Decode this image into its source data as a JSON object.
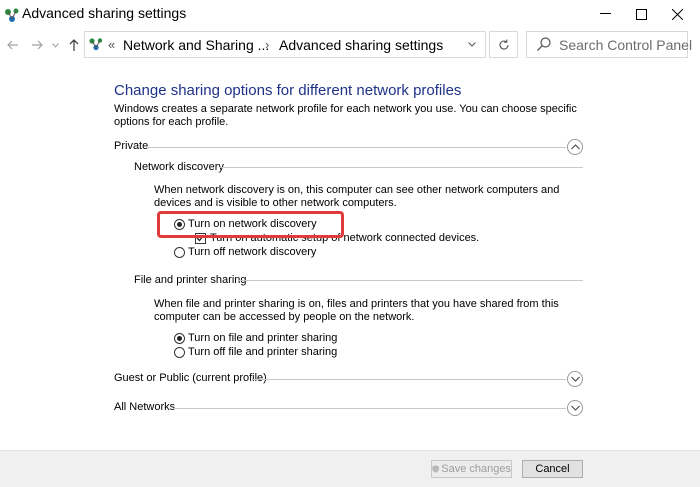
{
  "window": {
    "title": "Advanced sharing settings",
    "minimize_icon": "minimize-icon",
    "maximize_icon": "maximize-icon",
    "close_icon": "close-icon"
  },
  "nav": {
    "back_icon": "back-arrow-icon",
    "forward_icon": "forward-arrow-icon",
    "recent_icon": "chevron-down-icon",
    "up_icon": "up-arrow-icon",
    "breadcrumb_prefix": "«",
    "breadcrumbs": [
      "Network and Sharing ...",
      "Advanced sharing settings"
    ],
    "breadcrumb_sep": "›",
    "refresh_icon": "refresh-icon",
    "search_placeholder": "Search Control Panel"
  },
  "content": {
    "heading": "Change sharing options for different network profiles",
    "description": "Windows creates a separate network profile for each network you use. You can choose specific options for each profile.",
    "private": {
      "label": "Private",
      "expanded": true,
      "network_discovery": {
        "label": "Network discovery",
        "description": "When network discovery is on, this computer can see other network computers and devices and is visible to other network computers.",
        "options": [
          {
            "label": "Turn on network discovery",
            "selected": true
          },
          {
            "label": "Turn off network discovery",
            "selected": false
          }
        ],
        "auto_setup": {
          "label": "Turn on automatic setup of network connected devices.",
          "checked": true
        }
      },
      "file_printer_sharing": {
        "label": "File and printer sharing",
        "description": "When file and printer sharing is on, files and printers that you have shared from this computer can be accessed by people on the network.",
        "options": [
          {
            "label": "Turn on file and printer sharing",
            "selected": true
          },
          {
            "label": "Turn off file and printer sharing",
            "selected": false
          }
        ]
      }
    },
    "guest_public": {
      "label": "Guest or Public (current profile)",
      "expanded": false
    },
    "all_networks": {
      "label": "All Networks",
      "expanded": false
    }
  },
  "footer": {
    "save_label": "Save changes",
    "cancel_label": "Cancel"
  },
  "colors": {
    "heading": "#1e3287",
    "highlight": "#e13a3a"
  }
}
